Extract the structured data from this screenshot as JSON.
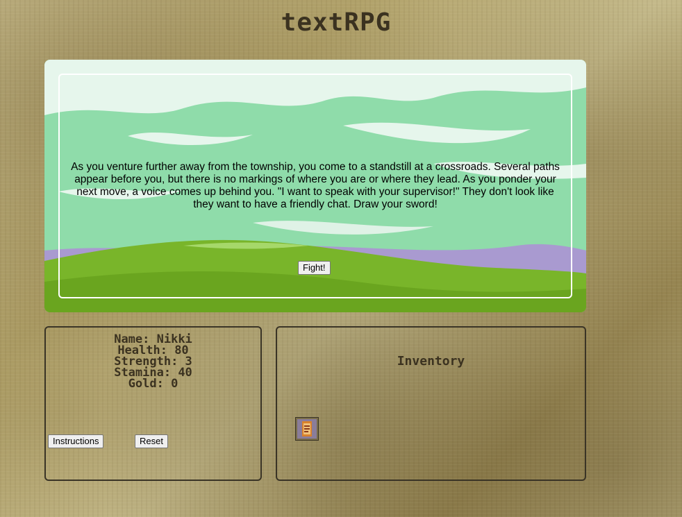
{
  "header": {
    "title": "textRPG"
  },
  "scene": {
    "story_text": "As you venture further away from the township, you come to a standstill at a crossroads. Several paths appear before you, but there is no markings of where you are or where they lead. As you ponder your next move, a voice comes up behind you. \"I want to speak with your supervisor!\" They don't look like they want to have a friendly chat. Draw your sword!",
    "action_label": "Fight!"
  },
  "stats": {
    "name": "Name: Nikki",
    "health": "Health: 80",
    "strength": "Strength: 3",
    "stamina": "Stamina: 40",
    "gold": "Gold: 0",
    "instructions_label": "Instructions",
    "reset_label": "Reset"
  },
  "inventory": {
    "title": "Inventory",
    "items": [
      {
        "icon": "scroll-item-icon"
      }
    ]
  },
  "colors": {
    "sky": "#8fdcaa",
    "hill": "#79b52a",
    "text_dark": "#3b3220"
  }
}
